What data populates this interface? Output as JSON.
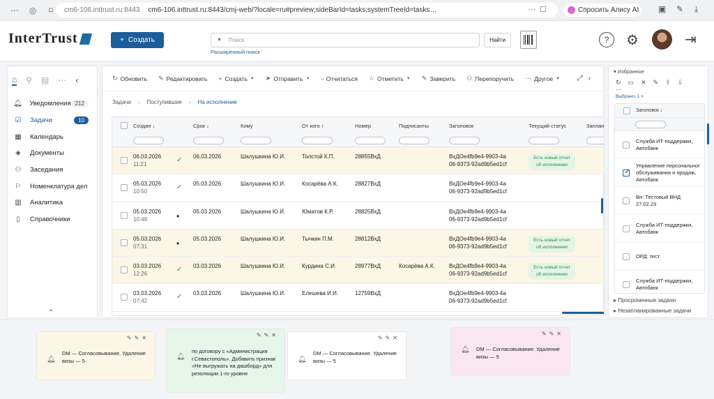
{
  "browser": {
    "host": "cm6-106.inttrust.ru:8443",
    "url": "cm6-106.inttrust.ru:8443/cmj-web/?locale=ru#preview;sideBarId=tasks;systemTreeId=tasks…",
    "alice": "Спросить Алису AI"
  },
  "header": {
    "logo": "InterTrust",
    "create": "Создать",
    "search_placeholder": "Поиск",
    "advanced_search": "Расширенный поиск",
    "find": "Найти"
  },
  "sidebar": {
    "items": [
      {
        "label": "Уведомления",
        "badge": "212",
        "icon": "bell-icon"
      },
      {
        "label": "Задачи",
        "badge": "10",
        "icon": "tasks-icon"
      },
      {
        "label": "Календарь",
        "badge": "",
        "icon": "calendar-icon"
      },
      {
        "label": "Документы",
        "badge": "",
        "icon": "documents-icon"
      },
      {
        "label": "Заседания",
        "badge": "",
        "icon": "meetings-icon"
      },
      {
        "label": "Номенклатура дел",
        "badge": "",
        "icon": "flag-icon"
      },
      {
        "label": "Аналитика",
        "badge": "",
        "icon": "analytics-icon"
      },
      {
        "label": "Справочники",
        "badge": "",
        "icon": "book-icon"
      }
    ]
  },
  "toolbar": {
    "refresh": "Обновить",
    "edit": "Редактировать",
    "create": "Создать",
    "send": "Отправить",
    "report": "Отчитаться",
    "mark": "Отметить",
    "approve": "Заверить",
    "reassign": "Перепоручить",
    "other": "Другое"
  },
  "breadcrumb": {
    "a": "Задачи",
    "b": "Поступившие",
    "c": "На исполнение"
  },
  "table": {
    "columns": {
      "created": "Создан",
      "due": "Срок",
      "to": "Кому",
      "from": "От кого",
      "number": "Номер",
      "signers": "Подписанты",
      "title": "Заголовок",
      "status": "Текущий статус",
      "planned": "Запланир"
    },
    "rows": [
      {
        "date": "06.03.2026",
        "time": "11:21",
        "mark": "✓",
        "due": "06.03.2026",
        "to": "Шалушкина Ю.И.",
        "from": "Толстой К.П.",
        "number": "28855ВхД",
        "signers": "",
        "h1": "ВхДОе4fb9e4-9903-4a",
        "h2": "06-9373-92ad9b5ed1cf",
        "status": "Есть новый отчет об исполнении",
        "hl": true
      },
      {
        "date": "05.03.2026",
        "time": "10:50",
        "mark": "✓",
        "due": "05.03.2026",
        "to": "Шалушкина Ю.И.",
        "from": "Косарёва А.К.",
        "number": "28827ВхД",
        "signers": "",
        "h1": "ВхДОе4fb9e4-9903-4a",
        "h2": "06-9373-92ad9b5ed1cf",
        "status": "",
        "hl": false
      },
      {
        "date": "05.03.2026",
        "time": "10:49",
        "mark": "•",
        "due": "05.03.2026",
        "to": "Шалушкина Ю.И.",
        "from": "Юматов К.Р.",
        "number": "28825ВхД",
        "signers": "",
        "h1": "ВхДОе4fb9e4-9903-4a",
        "h2": "06-9373-92ad9b5ed1cf",
        "status": "",
        "hl": false
      },
      {
        "date": "05.03.2026",
        "time": "07:31",
        "mark": "•",
        "due": "05.03.2026",
        "to": "Шалушкина Ю.И.",
        "from": "Тычкин П.М.",
        "number": "28812ВхД",
        "signers": "",
        "h1": "ВхДОе4fb9e4-9903-4a",
        "h2": "06-9373-92ad9b5ed1cf",
        "status": "Есть новый отчет об исполнении",
        "hl": true
      },
      {
        "date": "03.03.2026",
        "time": "12:26",
        "mark": "✓",
        "due": "03.03.2026",
        "to": "Шалушкина Ю.И.",
        "from": "Курдина С.И.",
        "number": "28977ВхД",
        "signers": "Косарёва А.К.",
        "h1": "ВхДОе4fb9e4-9903-4a",
        "h2": "06-9373-92ad9b5ed1cf",
        "status": "Есть новый отчет об исполнении",
        "hl": true
      },
      {
        "date": "03.03.2026",
        "time": "07:42",
        "mark": "✓",
        "due": "03.03.2026",
        "to": "Шалушкина Ю.И.",
        "from": "Елешева И.И.",
        "number": "12759ВхД",
        "signers": "",
        "h1": "ВхДОе4fb9e4-9903-4a",
        "h2": "06-9373-92ad9b5ed1cf",
        "status": "",
        "hl": false
      }
    ]
  },
  "right": {
    "favorites": "Избранное",
    "selected": "Выбрано: 1",
    "column": "Заголовок",
    "items": [
      {
        "text": "Служба ИТ-поддержки, Автобанк",
        "checked": false
      },
      {
        "text": "Управление персональног обслуживания и продаж, Автобанк",
        "checked": true
      },
      {
        "text": "Вн: Тестовый ВНД 27.02.23",
        "checked": false
      },
      {
        "text": "Служба ИТ-поддержки, Автобанк",
        "checked": false
      },
      {
        "text": "ОРД: тест",
        "checked": false
      },
      {
        "text": "Служба ИТ-поддержки, Автобанк",
        "checked": false
      }
    ],
    "overdue": "Просроченные задачи",
    "unplanned": "Незапланированные задачи"
  },
  "notifications": [
    {
      "text": "DM — Согласовывание. Удаление визы — 5",
      "bg": "#fcf6e6"
    },
    {
      "text": "по договору с «Администрация г.Севастополь». Добавить признак «Не выгружать на дашборд» для резолюции 1-го уровня",
      "bg": "#e6f6ea"
    },
    {
      "text": "DM — Согласовывание. Удаление визы — 5",
      "bg": "#ffffff"
    },
    {
      "text": "DM — Согласовывание. Удаление визы — 5",
      "bg": "#f9e6ee"
    }
  ],
  "colors": {
    "accent": "#1b5e9b",
    "highlight_row": "#fcf6e6",
    "status_green": "#2e8a47"
  }
}
